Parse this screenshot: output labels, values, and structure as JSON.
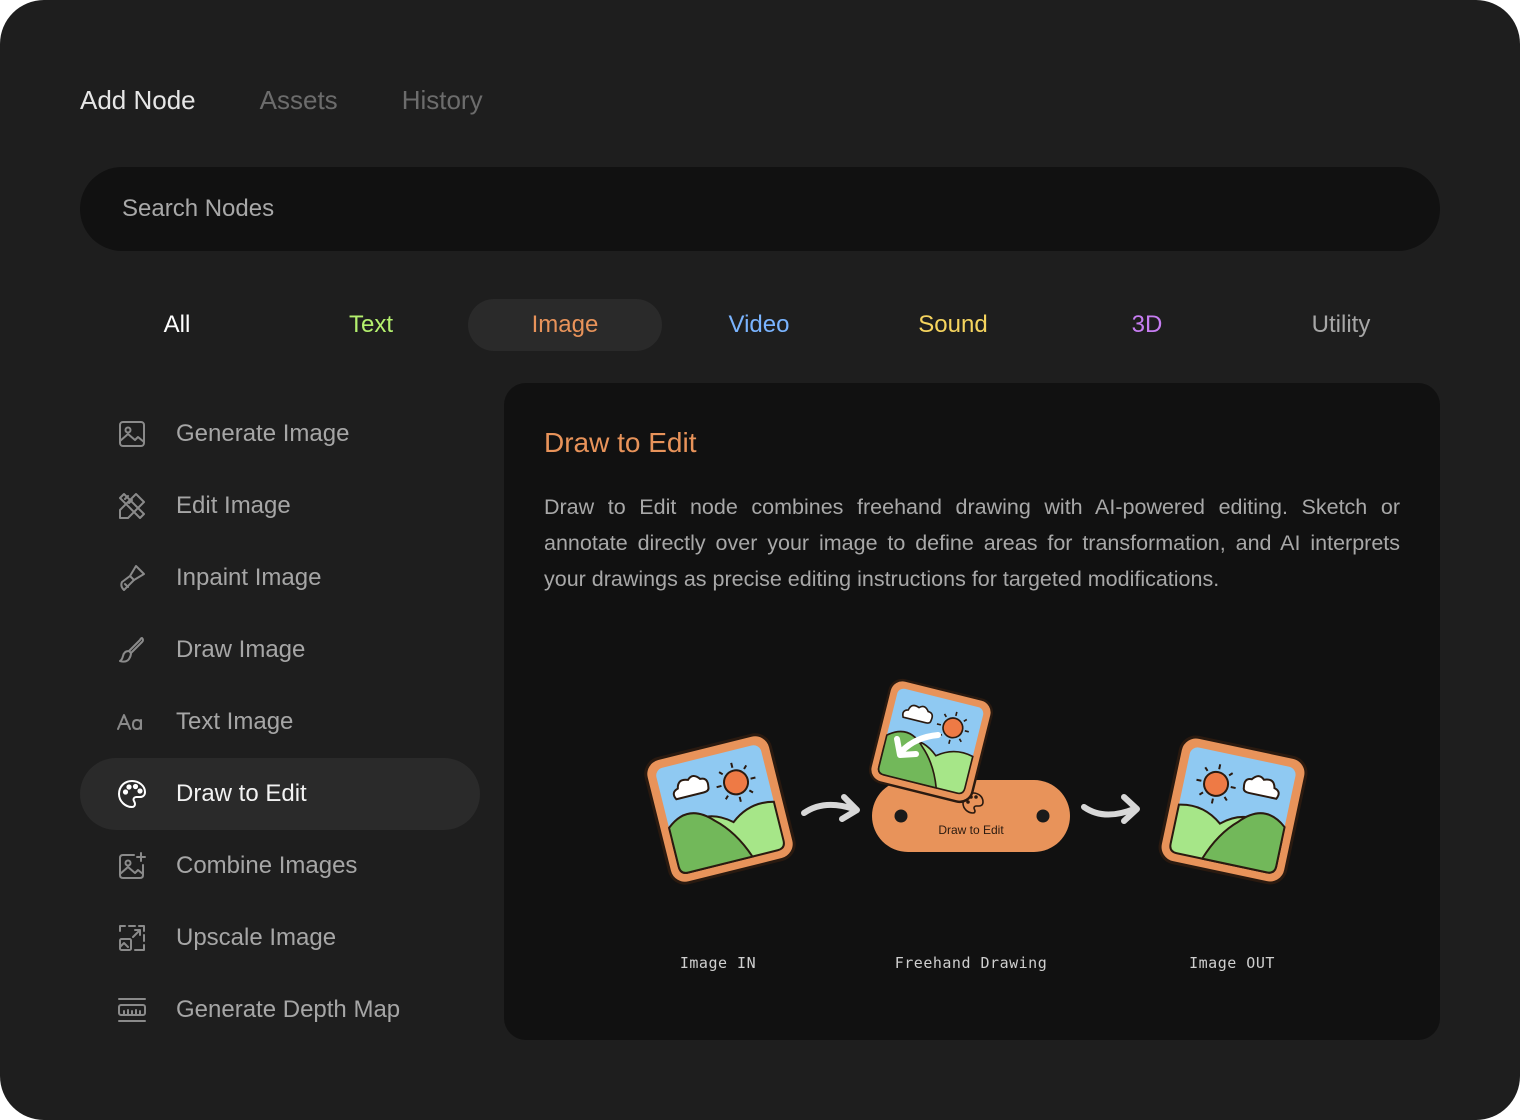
{
  "top_tabs": [
    "Add Node",
    "Assets",
    "History"
  ],
  "search": {
    "placeholder": "Search Nodes"
  },
  "categories": [
    {
      "label": "All",
      "color": "#ffffff"
    },
    {
      "label": "Text",
      "color": "#b4f06e"
    },
    {
      "label": "Image",
      "color": "#e8935a"
    },
    {
      "label": "Video",
      "color": "#7ab4ff"
    },
    {
      "label": "Sound",
      "color": "#f5d45e"
    },
    {
      "label": "3D",
      "color": "#c77df2"
    },
    {
      "label": "Utility",
      "color": "#a6a6a6"
    }
  ],
  "selected_category": "Image",
  "nodes": [
    {
      "label": "Generate Image",
      "icon": "image-icon"
    },
    {
      "label": "Edit Image",
      "icon": "edit-tools-icon"
    },
    {
      "label": "Inpaint Image",
      "icon": "brush-icon"
    },
    {
      "label": "Draw Image",
      "icon": "pen-brush-icon"
    },
    {
      "label": "Text Image",
      "icon": "text-aa-icon"
    },
    {
      "label": "Draw to Edit",
      "icon": "palette-icon"
    },
    {
      "label": "Combine Images",
      "icon": "image-plus-icon"
    },
    {
      "label": "Upscale Image",
      "icon": "upscale-icon"
    },
    {
      "label": "Generate Depth Map",
      "icon": "ruler-icon"
    }
  ],
  "selected_node": "Draw to Edit",
  "detail": {
    "title": "Draw to Edit",
    "description": "Draw to Edit node combines freehand drawing with AI-powered editing. Sketch or annotate directly over your image to define areas for transformation, and AI interprets your drawings as precise editing instructions for targeted modifications.",
    "node_badge": "Draw to Edit",
    "captions": [
      "Image IN",
      "Freehand Drawing",
      "Image OUT"
    ]
  },
  "colors": {
    "accent": "#e8935a",
    "panel": "#1e1e1e",
    "card": "#111111"
  }
}
